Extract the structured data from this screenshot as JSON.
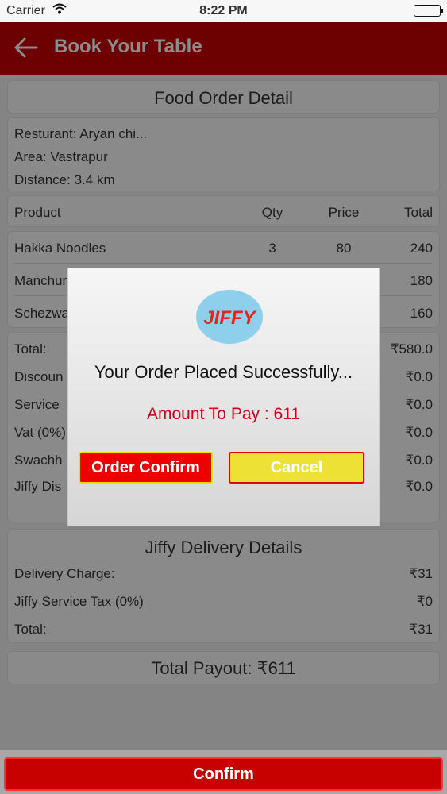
{
  "status_bar": {
    "carrier": "Carrier",
    "time": "8:22 PM"
  },
  "nav": {
    "title": "Book Your Table"
  },
  "food_order": {
    "title": "Food Order Detail",
    "restaurant": "Resturant: Aryan chi...",
    "area": "Area: Vastrapur",
    "distance": "Distance: 3.4 km",
    "headers": {
      "product": "Product",
      "qty": "Qty",
      "price": "Price",
      "total": "Total"
    },
    "items": [
      {
        "product": "Hakka Noodles",
        "qty": "3",
        "price": "80",
        "total": "240"
      },
      {
        "product": "Manchur",
        "qty": "",
        "price": "",
        "total": "180"
      },
      {
        "product": "Schezwa",
        "qty": "",
        "price": "",
        "total": "160"
      }
    ],
    "summary": [
      {
        "label": "Total:",
        "value": "₹580.0"
      },
      {
        "label": "Discoun",
        "value": "₹0.0"
      },
      {
        "label": "Service",
        "value": "₹0.0"
      },
      {
        "label": "Vat (0%)",
        "value": "₹0.0"
      },
      {
        "label": "Swachh",
        "value": "₹0.0"
      },
      {
        "label": "Jiffy Dis",
        "value": "₹0.0"
      }
    ]
  },
  "delivery": {
    "title": "Jiffy Delivery Details",
    "rows": [
      {
        "label": "Delivery Charge:",
        "value": "₹31"
      },
      {
        "label": "Jiffy Service Tax (0%)",
        "value": "₹0"
      },
      {
        "label": "Total:",
        "value": "₹31"
      }
    ]
  },
  "payout": {
    "label": "Total Payout: ₹611"
  },
  "modal": {
    "logo_text": "JIFFY",
    "message": "Your Order Placed Successfully...",
    "amount": "Amount To Pay : 611",
    "confirm_label": "Order Confirm",
    "cancel_label": "Cancel"
  },
  "footer": {
    "confirm_label": "Confirm"
  },
  "colors": {
    "brand_red": "#c70000",
    "modal_yellow": "#ece134",
    "amount_red": "#d0021b"
  }
}
